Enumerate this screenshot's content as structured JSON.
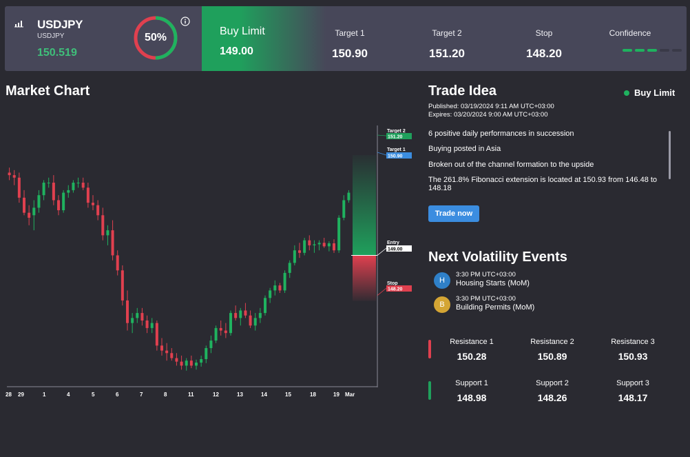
{
  "header": {
    "symbol": "USDJPY",
    "symbol_sub": "USDJPY",
    "price": "150.519",
    "confidence_pct": "50%",
    "confidence_value": 0.5,
    "order_type": "Buy Limit",
    "entry": "149.00",
    "target1_label": "Target 1",
    "target1": "150.90",
    "target2_label": "Target 2",
    "target2": "151.20",
    "stop_label": "Stop",
    "stop": "148.20",
    "confidence_label": "Confidence",
    "confidence_dashes": {
      "filled": 3,
      "total": 5
    },
    "colors": {
      "green": "#1fa05c",
      "red": "#e0404f",
      "blue": "#3b8de0"
    }
  },
  "chart": {
    "title": "Market Chart",
    "markers": {
      "target2": {
        "label": "Target 2",
        "value": "151.20"
      },
      "target1": {
        "label": "Target 1",
        "value": "150.90"
      },
      "entry": {
        "label": "Entry",
        "value": "149.00"
      },
      "stop": {
        "label": "Stop",
        "value": "148.20"
      }
    }
  },
  "chart_data": {
    "type": "candlestick",
    "x_labels": [
      "28",
      "29",
      "1",
      "4",
      "5",
      "6",
      "7",
      "8",
      "11",
      "12",
      "13",
      "14",
      "15",
      "18",
      "19",
      "Mar"
    ],
    "ylim": [
      147.2,
      151.6
    ],
    "candles": [
      {
        "o": 150.65,
        "h": 150.75,
        "l": 150.5,
        "c": 150.6
      },
      {
        "o": 150.6,
        "h": 150.7,
        "l": 150.4,
        "c": 150.55
      },
      {
        "o": 150.55,
        "h": 150.65,
        "l": 150.05,
        "c": 150.15
      },
      {
        "o": 150.15,
        "h": 150.3,
        "l": 149.8,
        "c": 149.85
      },
      {
        "o": 149.85,
        "h": 150.0,
        "l": 149.6,
        "c": 149.75
      },
      {
        "o": 149.8,
        "h": 150.1,
        "l": 149.5,
        "c": 149.95
      },
      {
        "o": 149.95,
        "h": 150.3,
        "l": 149.85,
        "c": 150.2
      },
      {
        "o": 150.2,
        "h": 150.5,
        "l": 150.1,
        "c": 150.45
      },
      {
        "o": 150.45,
        "h": 150.55,
        "l": 150.35,
        "c": 150.45
      },
      {
        "o": 150.45,
        "h": 150.6,
        "l": 150.0,
        "c": 150.1
      },
      {
        "o": 150.1,
        "h": 150.2,
        "l": 149.8,
        "c": 149.9
      },
      {
        "o": 149.9,
        "h": 150.3,
        "l": 149.85,
        "c": 150.25
      },
      {
        "o": 150.25,
        "h": 150.4,
        "l": 150.15,
        "c": 150.3
      },
      {
        "o": 150.3,
        "h": 150.5,
        "l": 150.25,
        "c": 150.45
      },
      {
        "o": 150.45,
        "h": 150.55,
        "l": 150.35,
        "c": 150.45
      },
      {
        "o": 150.45,
        "h": 150.55,
        "l": 150.3,
        "c": 150.35
      },
      {
        "o": 150.35,
        "h": 150.45,
        "l": 149.95,
        "c": 150.05
      },
      {
        "o": 150.05,
        "h": 150.2,
        "l": 149.9,
        "c": 150.0
      },
      {
        "o": 150.0,
        "h": 150.1,
        "l": 149.7,
        "c": 149.8
      },
      {
        "o": 149.8,
        "h": 149.95,
        "l": 149.3,
        "c": 149.4
      },
      {
        "o": 149.4,
        "h": 149.6,
        "l": 149.2,
        "c": 149.5
      },
      {
        "o": 149.5,
        "h": 149.7,
        "l": 148.9,
        "c": 149.0
      },
      {
        "o": 149.0,
        "h": 149.1,
        "l": 148.6,
        "c": 148.7
      },
      {
        "o": 148.7,
        "h": 148.8,
        "l": 148.0,
        "c": 148.1
      },
      {
        "o": 148.1,
        "h": 148.3,
        "l": 147.5,
        "c": 147.65
      },
      {
        "o": 147.65,
        "h": 147.85,
        "l": 147.45,
        "c": 147.75
      },
      {
        "o": 147.75,
        "h": 147.95,
        "l": 147.65,
        "c": 147.85
      },
      {
        "o": 147.85,
        "h": 147.95,
        "l": 147.6,
        "c": 147.7
      },
      {
        "o": 147.7,
        "h": 147.8,
        "l": 147.45,
        "c": 147.55
      },
      {
        "o": 147.55,
        "h": 147.75,
        "l": 147.45,
        "c": 147.65
      },
      {
        "o": 147.65,
        "h": 147.7,
        "l": 147.1,
        "c": 147.2
      },
      {
        "o": 147.2,
        "h": 147.35,
        "l": 147.0,
        "c": 147.1
      },
      {
        "o": 147.1,
        "h": 147.25,
        "l": 146.9,
        "c": 147.05
      },
      {
        "o": 147.05,
        "h": 147.15,
        "l": 146.9,
        "c": 146.95
      },
      {
        "o": 146.95,
        "h": 147.05,
        "l": 146.8,
        "c": 146.88
      },
      {
        "o": 146.88,
        "h": 147.0,
        "l": 146.72,
        "c": 146.8
      },
      {
        "o": 146.8,
        "h": 146.95,
        "l": 146.7,
        "c": 146.9
      },
      {
        "o": 146.9,
        "h": 147.0,
        "l": 146.75,
        "c": 146.8
      },
      {
        "o": 146.8,
        "h": 146.92,
        "l": 146.72,
        "c": 146.86
      },
      {
        "o": 146.86,
        "h": 147.0,
        "l": 146.78,
        "c": 146.93
      },
      {
        "o": 146.93,
        "h": 147.2,
        "l": 146.85,
        "c": 147.15
      },
      {
        "o": 147.15,
        "h": 147.4,
        "l": 147.05,
        "c": 147.3
      },
      {
        "o": 147.3,
        "h": 147.6,
        "l": 147.25,
        "c": 147.55
      },
      {
        "o": 147.55,
        "h": 147.7,
        "l": 147.4,
        "c": 147.5
      },
      {
        "o": 147.5,
        "h": 147.65,
        "l": 147.35,
        "c": 147.45
      },
      {
        "o": 147.45,
        "h": 147.9,
        "l": 147.4,
        "c": 147.85
      },
      {
        "o": 147.85,
        "h": 148.0,
        "l": 147.7,
        "c": 147.75
      },
      {
        "o": 147.75,
        "h": 147.95,
        "l": 147.6,
        "c": 147.9
      },
      {
        "o": 147.9,
        "h": 148.05,
        "l": 147.75,
        "c": 147.8
      },
      {
        "o": 147.8,
        "h": 147.9,
        "l": 147.55,
        "c": 147.6
      },
      {
        "o": 147.6,
        "h": 147.85,
        "l": 147.5,
        "c": 147.75
      },
      {
        "o": 147.75,
        "h": 147.95,
        "l": 147.65,
        "c": 147.85
      },
      {
        "o": 147.85,
        "h": 148.2,
        "l": 147.8,
        "c": 148.15
      },
      {
        "o": 148.15,
        "h": 148.35,
        "l": 148.05,
        "c": 148.3
      },
      {
        "o": 148.3,
        "h": 148.5,
        "l": 148.2,
        "c": 148.4
      },
      {
        "o": 148.4,
        "h": 148.45,
        "l": 148.25,
        "c": 148.3
      },
      {
        "o": 148.3,
        "h": 148.7,
        "l": 148.25,
        "c": 148.65
      },
      {
        "o": 148.65,
        "h": 148.9,
        "l": 148.55,
        "c": 148.85
      },
      {
        "o": 148.85,
        "h": 149.2,
        "l": 148.8,
        "c": 149.1
      },
      {
        "o": 149.1,
        "h": 149.25,
        "l": 148.95,
        "c": 149.05
      },
      {
        "o": 149.05,
        "h": 149.35,
        "l": 149.0,
        "c": 149.3
      },
      {
        "o": 149.3,
        "h": 149.4,
        "l": 149.1,
        "c": 149.2
      },
      {
        "o": 149.2,
        "h": 149.3,
        "l": 149.05,
        "c": 149.22
      },
      {
        "o": 149.22,
        "h": 149.3,
        "l": 149.1,
        "c": 149.25
      },
      {
        "o": 149.25,
        "h": 149.35,
        "l": 149.15,
        "c": 149.18
      },
      {
        "o": 149.18,
        "h": 149.28,
        "l": 149.08,
        "c": 149.24
      },
      {
        "o": 149.24,
        "h": 149.32,
        "l": 149.05,
        "c": 149.1
      },
      {
        "o": 149.1,
        "h": 149.8,
        "l": 149.05,
        "c": 149.75
      },
      {
        "o": 149.75,
        "h": 150.2,
        "l": 149.7,
        "c": 150.1
      },
      {
        "o": 150.1,
        "h": 150.3,
        "l": 150.05,
        "c": 150.25
      }
    ],
    "levels": {
      "target2": 151.2,
      "target1": 150.9,
      "entry": 149.0,
      "stop": 148.2
    }
  },
  "trade_idea": {
    "title": "Trade Idea",
    "badge": "Buy Limit",
    "published": "Published:  03/19/2024 9:11 AM UTC+03:00",
    "expires": "Expires:  03/20/2024 9:00 AM UTC+03:00",
    "items": [
      "6 positive daily performances in succession",
      "Buying posted in Asia",
      "Broken out of the channel formation to the upside",
      "The 261.8% Fibonacci extension is located at 150.93 from 146.48 to 148.18"
    ],
    "button": "Trade now"
  },
  "volatility": {
    "title": "Next Volatility Events",
    "events": [
      {
        "letter": "H",
        "time": "3:30 PM UTC+03:00",
        "name": "Housing Starts (MoM)",
        "color": "#2f80c8"
      },
      {
        "letter": "B",
        "time": "3:30 PM UTC+03:00",
        "name": "Building Permits (MoM)",
        "color": "#d4a534"
      }
    ]
  },
  "levels": {
    "resistance": [
      {
        "label": "Resistance 1",
        "value": "150.28"
      },
      {
        "label": "Resistance 2",
        "value": "150.89"
      },
      {
        "label": "Resistance 3",
        "value": "150.93"
      }
    ],
    "support": [
      {
        "label": "Support 1",
        "value": "148.98"
      },
      {
        "label": "Support 2",
        "value": "148.26"
      },
      {
        "label": "Support 3",
        "value": "148.17"
      }
    ]
  }
}
